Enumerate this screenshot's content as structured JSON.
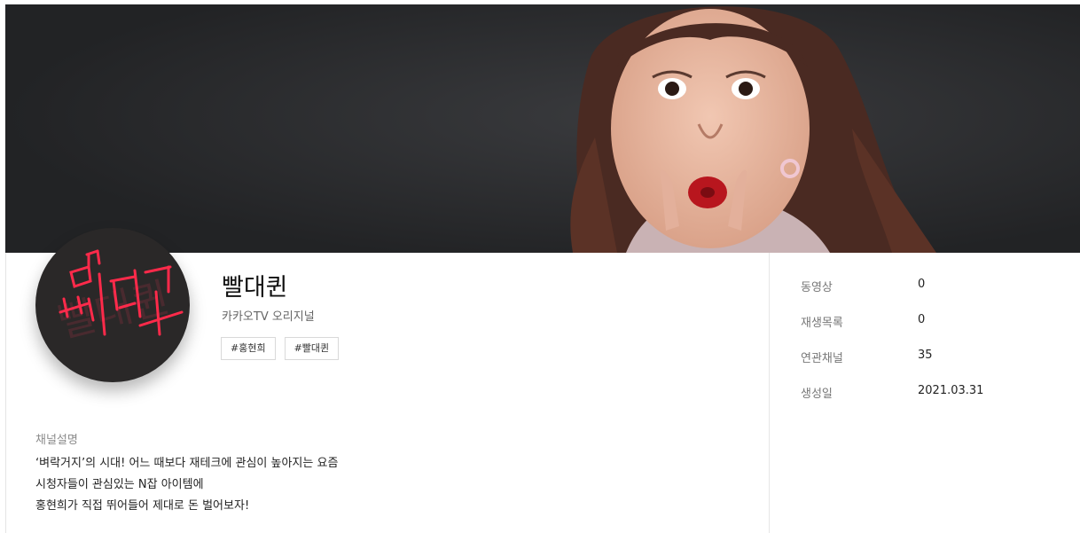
{
  "channel": {
    "name": "빨대퀸",
    "subtitle": "카카오TV 오리지널",
    "logo_text": "빨대퀸",
    "tags": [
      "#홍현희",
      "#빨대퀸"
    ]
  },
  "description": {
    "label": "채널설명",
    "lines": [
      "‘벼락거지’의 시대! 어느 때보다 재테크에 관심이 높아지는 요즘",
      "시청자들이 관심있는 N잡 아이템에",
      "홍현희가 직접 뛰어들어 제대로 돈 벌어보자!"
    ]
  },
  "stats": [
    {
      "label": "동영상",
      "value": "0"
    },
    {
      "label": "재생목록",
      "value": "0"
    },
    {
      "label": "연관채널",
      "value": "35"
    },
    {
      "label": "생성일",
      "value": "2021.03.31"
    }
  ],
  "colors": {
    "banner_bg": "#2a2b2d",
    "logo_neon": "#ff2a4a",
    "avatar_bg": "#2a2828"
  }
}
